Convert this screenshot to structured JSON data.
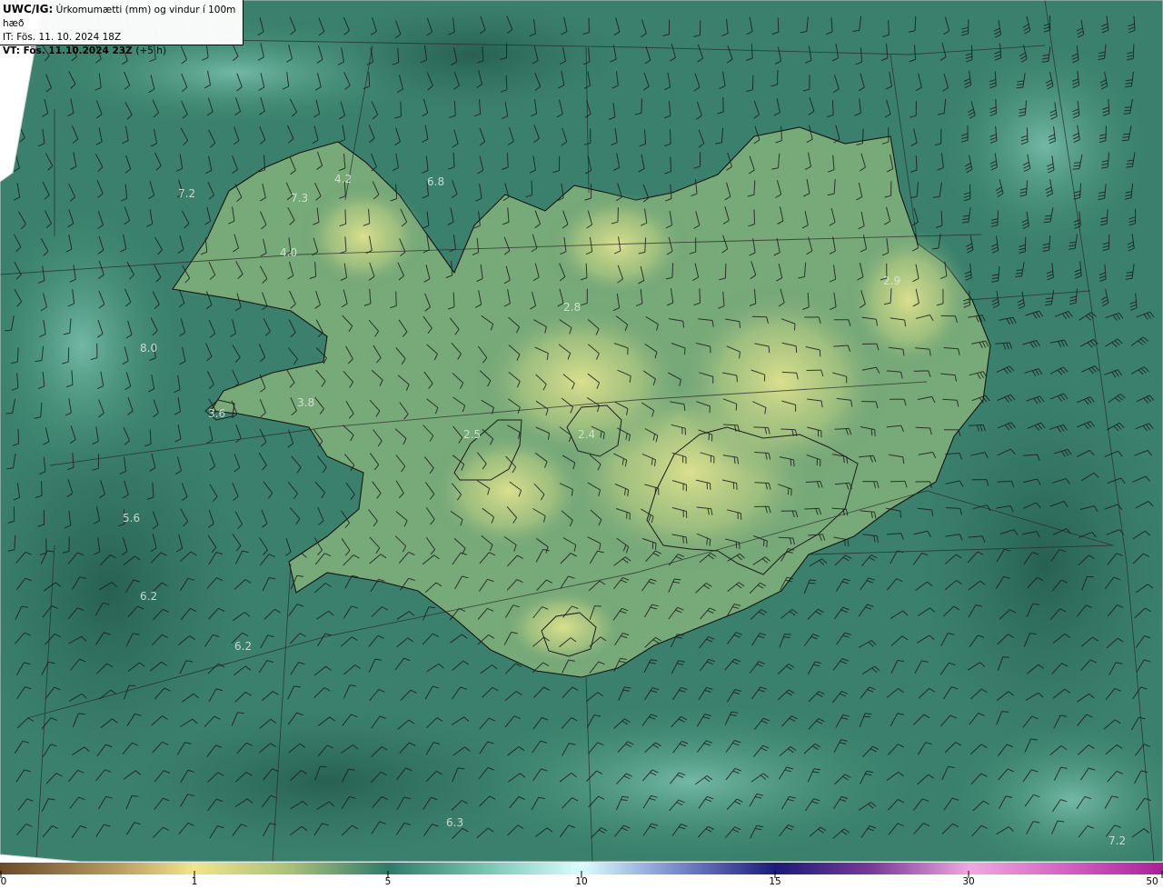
{
  "header": {
    "prefix": "UWC/IG:",
    "title": "Úrkomumætti (mm) og vindur í 100m hæð",
    "issue_time": "IT: Fös. 11. 10. 2024 18Z",
    "valid_time": "VT: Fös. 11.10.2024 23Z",
    "valid_offset": "(+5 h)"
  },
  "map_values": [
    {
      "name": "value-label-north-4-2",
      "text": "4.2"
    },
    {
      "name": "value-label-north-6-8",
      "text": "6.8"
    },
    {
      "name": "value-label-west-7-2",
      "text": "7.2"
    },
    {
      "name": "value-label-westfjords-7-3",
      "text": "7.3"
    },
    {
      "name": "value-label-westfjords-4-0",
      "text": "4.0"
    },
    {
      "name": "value-label-north-2-8",
      "text": "2.8"
    },
    {
      "name": "value-label-east-2-9",
      "text": "2.9"
    },
    {
      "name": "value-label-west-8-0",
      "text": "8.0"
    },
    {
      "name": "value-label-snaefells-3-6",
      "text": "3.6"
    },
    {
      "name": "value-label-west-3-8",
      "text": "3.8"
    },
    {
      "name": "value-label-central-2-5",
      "text": "2.5"
    },
    {
      "name": "value-label-central-2-4",
      "text": "2.4"
    },
    {
      "name": "value-label-sw-5-6",
      "text": "5.6"
    },
    {
      "name": "value-label-sw-6-2a",
      "text": "6.2"
    },
    {
      "name": "value-label-sw-6-2b",
      "text": "6.2"
    },
    {
      "name": "value-label-south-6-3",
      "text": "6.3"
    },
    {
      "name": "value-label-se-7-2",
      "text": "7.2"
    }
  ],
  "colorbar": {
    "ticks": [
      "0",
      "1",
      "5",
      "10",
      "15",
      "30",
      "50"
    ],
    "colors": {
      "c0": "#6b4a2a",
      "c1": "#f2e58a",
      "c5": "#2f7a6a",
      "c10": "#d9ffff",
      "c15": "#1b1a7a",
      "c30": "#f0a8e0",
      "c50": "#a8209a"
    }
  },
  "colors": {
    "sea_dark": "#2e6d5d",
    "sea_mid": "#3f8a72",
    "sea_light": "#6fb4a2",
    "land_high": "#cfd58a",
    "land_mid": "#7fae7a",
    "coastline": "#1a1a1a",
    "barb": "#1e1e1e"
  }
}
